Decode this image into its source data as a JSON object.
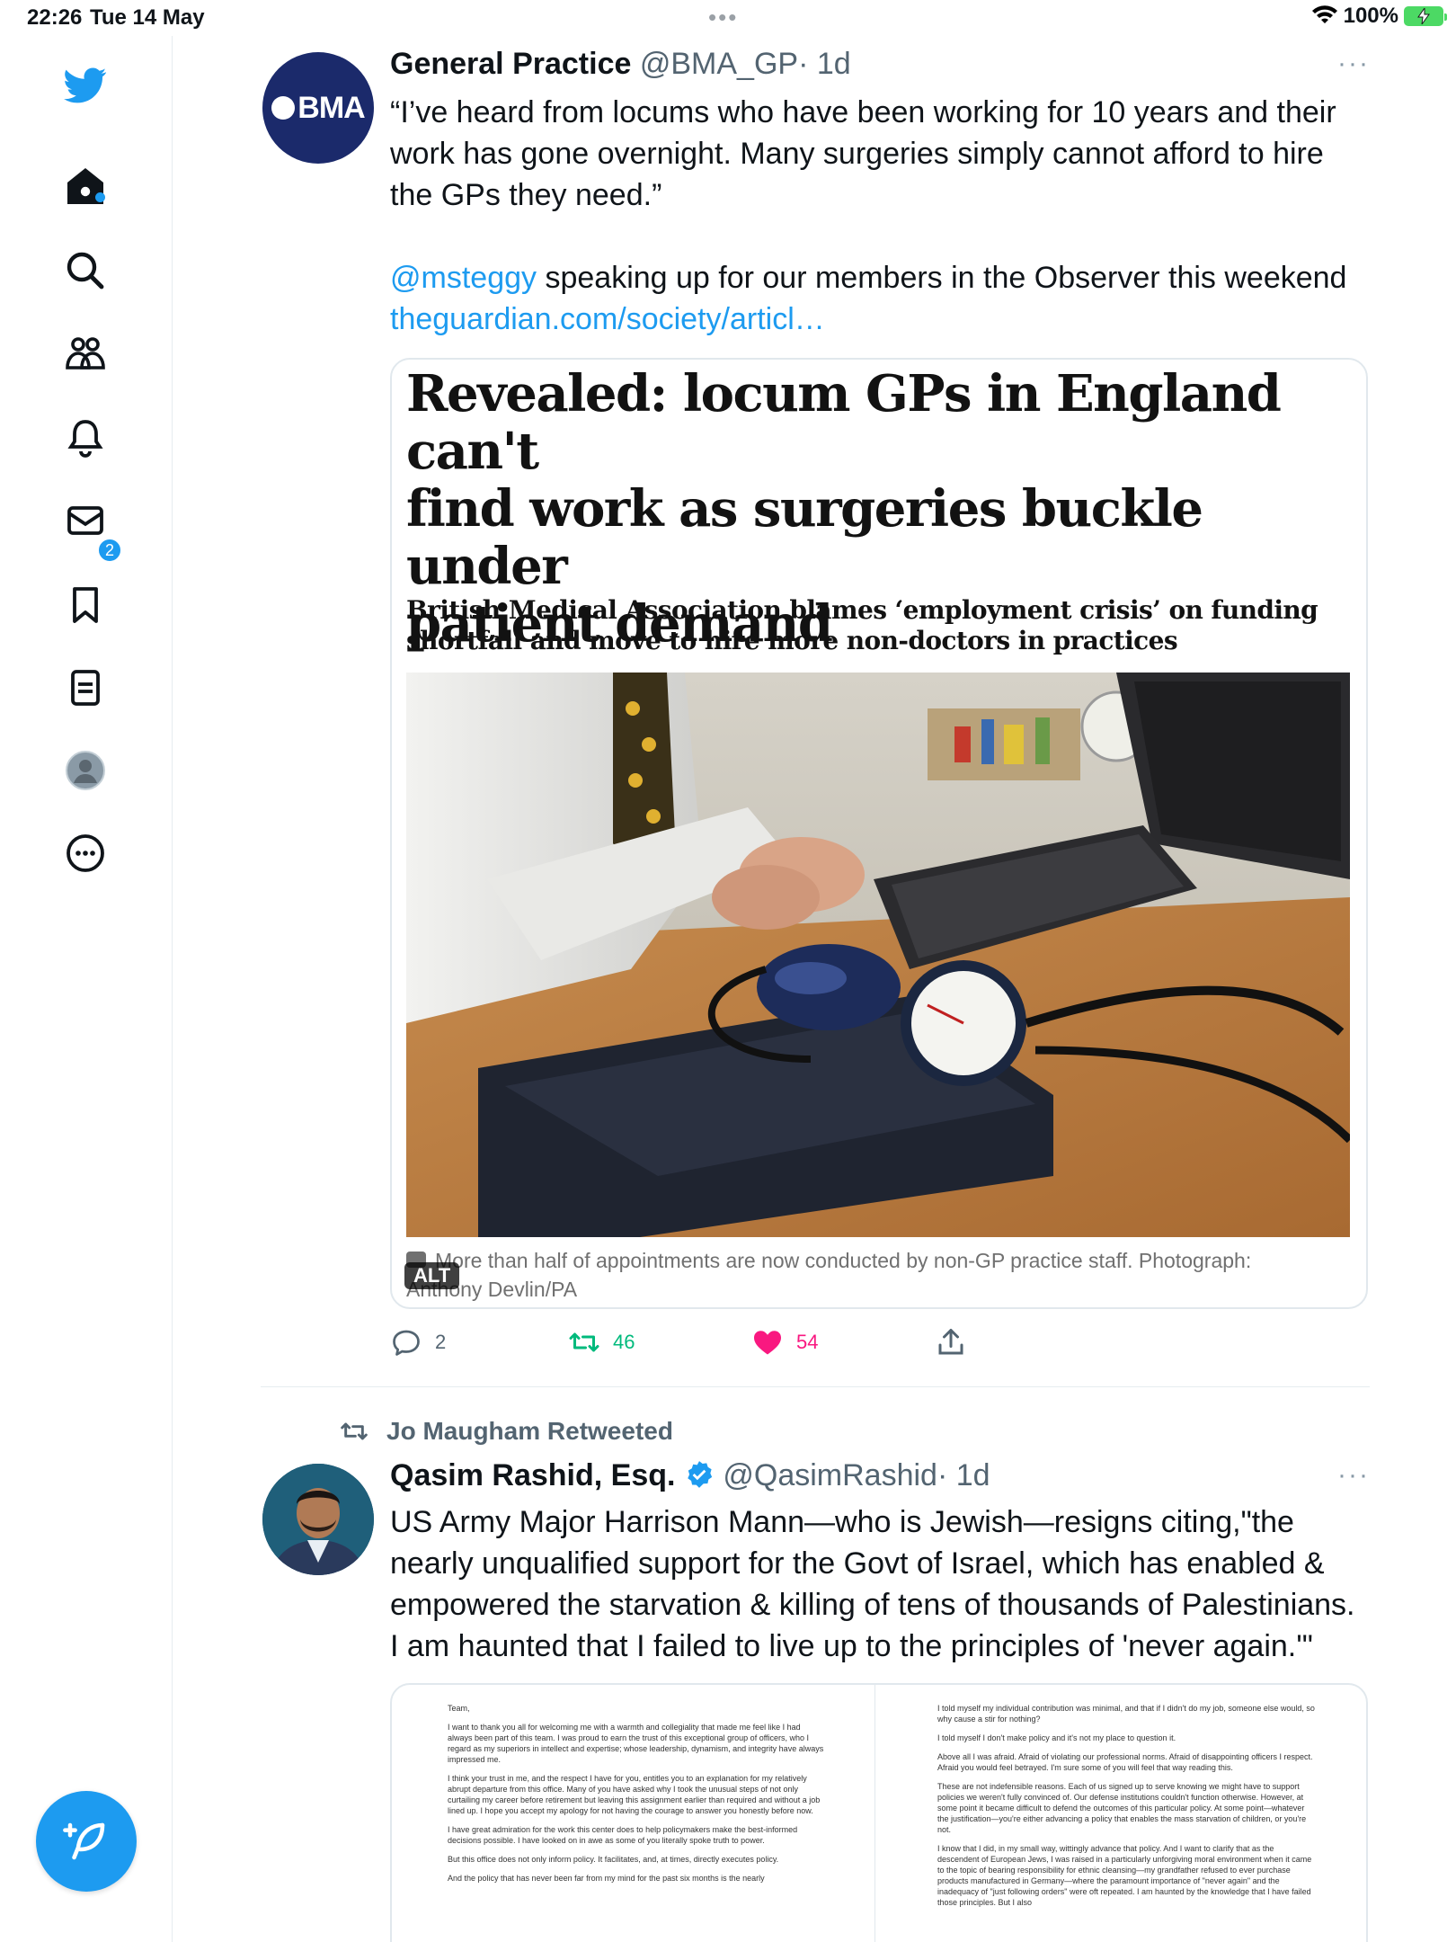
{
  "status_bar": {
    "time": "22:26",
    "date": "Tue 14 May",
    "battery": "100%"
  },
  "sidebar": {
    "items": [
      {
        "name": "twitter-logo"
      },
      {
        "name": "home"
      },
      {
        "name": "explore"
      },
      {
        "name": "communities"
      },
      {
        "name": "notifications",
        "badge": "2"
      },
      {
        "name": "messages"
      },
      {
        "name": "bookmarks"
      },
      {
        "name": "lists"
      },
      {
        "name": "profile"
      },
      {
        "name": "more"
      }
    ],
    "accent_color": "#1d9bf0"
  },
  "tweet1": {
    "avatar_text": "BMA",
    "name": "General Practice",
    "handle": "@BMA_GP",
    "time": "· 1d",
    "more": "···",
    "text_line1": "“I’ve heard from locums who have been working for 10 years and their",
    "text_line2": "work has gone overnight. Many surgeries simply cannot afford to hire",
    "text_line3": "the GPs they need.”",
    "mention": "@msteggy",
    "text_after_mention": " speaking up for our members in the Observer this weekend",
    "link": "theguardian.com/society/articl…",
    "card": {
      "headline_line1": "Revealed: locum GPs in England can't",
      "headline_line2": "find work as surgeries buckle under",
      "headline_line3": "patient demand",
      "subhead_line1": "British Medical Association blames ‘employment crisis’ on funding",
      "subhead_line2": "shortfall and move to hire more non-doctors in practices",
      "caption_line1": "More than half of appointments are now conducted by non-GP practice staff. Photograph:",
      "caption_line2": "Anthony Devlin/PA",
      "alt_label": "ALT"
    },
    "stats": {
      "replies": "2",
      "retweets": "46",
      "likes": "54"
    },
    "colors": {
      "retweet": "#00ba7c",
      "like": "#f91880"
    }
  },
  "tweet2": {
    "retweeted_by": "Jo Maugham Retweeted",
    "name": "Qasim Rashid, Esq.",
    "handle": "@QasimRashid",
    "time": "· 1d",
    "more": "···",
    "text_line1": "US Army Major Harrison Mann—who is Jewish—resigns citing,\"the",
    "text_line2": "nearly unqualified support for the Govt of Israel, which has enabled &",
    "text_line3": "empowered the starvation & killing of tens of thousands of Palestinians.",
    "text_line4": "I am haunted that I failed to live up to the principles of 'never again.'\"",
    "letter_left": [
      "Team,",
      "I want to thank you all for welcoming me with a warmth and collegiality that made me feel like I had always been part of this team. I was proud to earn the trust of this exceptional group of officers, who I regard as my superiors in intellect and expertise; whose leadership, dynamism, and integrity have always impressed me.",
      "I think your trust in me, and the respect I have for you, entitles you to an explanation for my relatively abrupt departure from this office. Many of you have asked why I took the unusual steps of not only curtailing my career before retirement but leaving this assignment earlier than required and without a job lined up. I hope you accept my apology for not having the courage to answer you honestly before now.",
      "I have great admiration for the work this center does to help policymakers make the best-informed decisions possible. I have looked on in awe as some of you literally spoke truth to power.",
      "But this office does not only inform policy. It facilitates, and, at times, directly executes policy.",
      "And the policy that has never been far from my mind for the past six months is the nearly"
    ],
    "letter_right": [
      "I told myself my individual contribution was minimal, and that if I didn't do my job, someone else would, so why cause a stir for nothing?",
      "I told myself I don't make policy and it's not my place to question it.",
      "Above all I was afraid. Afraid of violating our professional norms. Afraid of disappointing officers I respect. Afraid you would feel betrayed. I'm sure some of you will feel that way reading this.",
      "These are not indefensible reasons. Each of us signed up to serve knowing we might have to support policies we weren't fully convinced of. Our defense institutions couldn't function otherwise. However, at some point it became difficult to defend the outcomes of this particular policy. At some point—whatever the justification—you're either advancing a policy that enables the mass starvation of children, or you're not.",
      "I know that I did, in my small way, wittingly advance that policy. And I want to clarify that as the descendent of European Jews, I was raised in a particularly unforgiving moral environment when it came to the topic of bearing responsibility for ethnic cleansing—my grandfather refused to ever purchase products manufactured in Germany—where the paramount importance of \"never again\" and the inadequacy of \"just following orders\" were oft repeated. I am haunted by the knowledge that I have failed those principles. But I also"
    ]
  }
}
